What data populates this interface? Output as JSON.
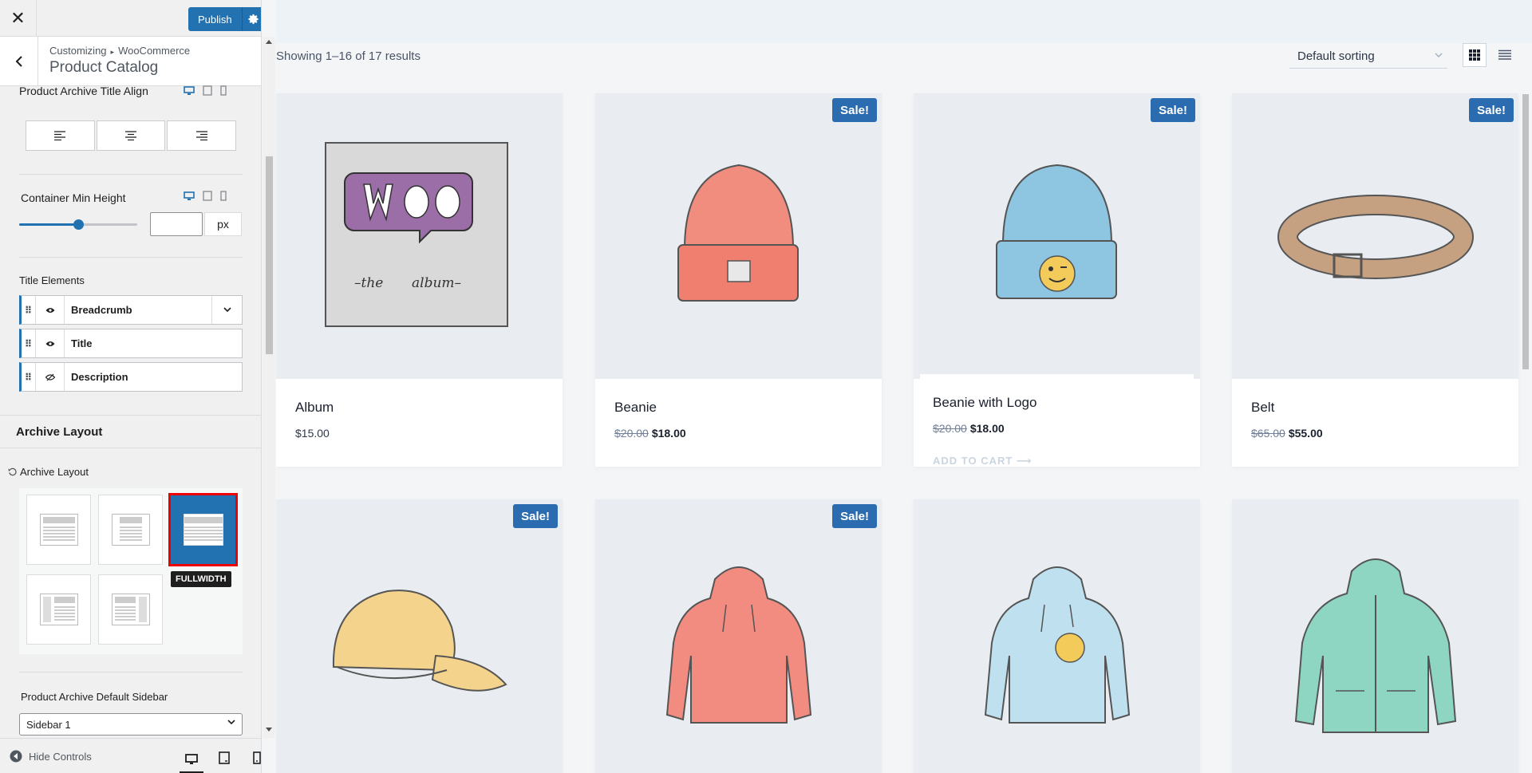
{
  "topbar": {
    "close": "✕",
    "publish_label": "Publish"
  },
  "section": {
    "crumb_root": "Customizing",
    "crumb_sep": "▸",
    "crumb_parent": "WooCommerce",
    "title": "Product Catalog"
  },
  "panel": {
    "title_align_label": "Product Archive Title Align",
    "min_height_label": "Container Min Height",
    "min_height_value": "",
    "min_height_unit": "px",
    "slider_level": 0.5,
    "title_elements_label": "Title Elements",
    "title_elements": [
      {
        "label": "Breadcrumb",
        "visible": true,
        "has_dropdown": true
      },
      {
        "label": "Title",
        "visible": true,
        "has_dropdown": false
      },
      {
        "label": "Description",
        "visible": false,
        "has_dropdown": false
      }
    ],
    "archive_heading": "Archive Layout",
    "archive_layout_label": "Archive Layout",
    "layout_tooltip": "FULLWIDTH",
    "default_sidebar_label": "Product Archive Default Sidebar",
    "default_sidebar_value": "Sidebar 1"
  },
  "footer": {
    "hide_controls": "Hide Controls"
  },
  "colors": {
    "accent": "#2271b1",
    "sale": "#2b6cb0",
    "highlight": "#ee0000"
  },
  "shop": {
    "result_count": "Showing 1–16 of 17 results",
    "sort_value": "Default sorting",
    "products": [
      {
        "name": "Album",
        "old_price": "",
        "price": "$15.00",
        "sale": false,
        "sale_label": "",
        "add_to_cart": ""
      },
      {
        "name": "Beanie",
        "old_price": "$20.00",
        "price": "$18.00",
        "sale": true,
        "sale_label": "Sale!",
        "add_to_cart": ""
      },
      {
        "name": "Beanie with Logo",
        "old_price": "$20.00",
        "price": "$18.00",
        "sale": true,
        "sale_label": "Sale!",
        "add_to_cart": "ADD TO CART ⟶"
      },
      {
        "name": "Belt",
        "old_price": "$65.00",
        "price": "$55.00",
        "sale": true,
        "sale_label": "Sale!",
        "add_to_cart": ""
      },
      {
        "name": "",
        "old_price": "",
        "price": "",
        "sale": true,
        "sale_label": "Sale!",
        "add_to_cart": ""
      },
      {
        "name": "",
        "old_price": "",
        "price": "",
        "sale": true,
        "sale_label": "Sale!",
        "add_to_cart": ""
      },
      {
        "name": "",
        "old_price": "",
        "price": "",
        "sale": false,
        "sale_label": "",
        "add_to_cart": ""
      },
      {
        "name": "",
        "old_price": "",
        "price": "",
        "sale": false,
        "sale_label": "",
        "add_to_cart": ""
      }
    ]
  }
}
